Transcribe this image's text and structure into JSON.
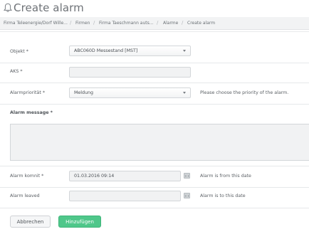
{
  "page": {
    "title": "Create alarm"
  },
  "breadcrumb": [
    "Firma Teleenergie/Dorf Wille...",
    "Firmen",
    "Firma Taeschmann auts...",
    "Alarme",
    "Create alarm"
  ],
  "form": {
    "objekt": {
      "label": "Objekt *",
      "value": "ABC060D Messestand [MST]"
    },
    "aks": {
      "label": "AKS *",
      "value": ""
    },
    "priority": {
      "label": "Alarmpriorität *",
      "value": "Meldung",
      "hint": "Please choose the priority of the alarm."
    },
    "message": {
      "label": "Alarm message *",
      "value": ""
    },
    "komnit": {
      "label": "Alarm komnit *",
      "value": "01.03.2016 09:14",
      "hint": "Alarm is from this date"
    },
    "leaved": {
      "label": "Alarm leaved",
      "value": "",
      "hint": "Alarm is to this date"
    }
  },
  "buttons": {
    "cancel": "Abbrechen",
    "add": "Hinzufügen"
  },
  "icons": {
    "bell": "bell-icon",
    "calendar": "calendar-icon",
    "caret": "chevron-down-icon"
  },
  "colors": {
    "accent": "#4fc78a"
  }
}
